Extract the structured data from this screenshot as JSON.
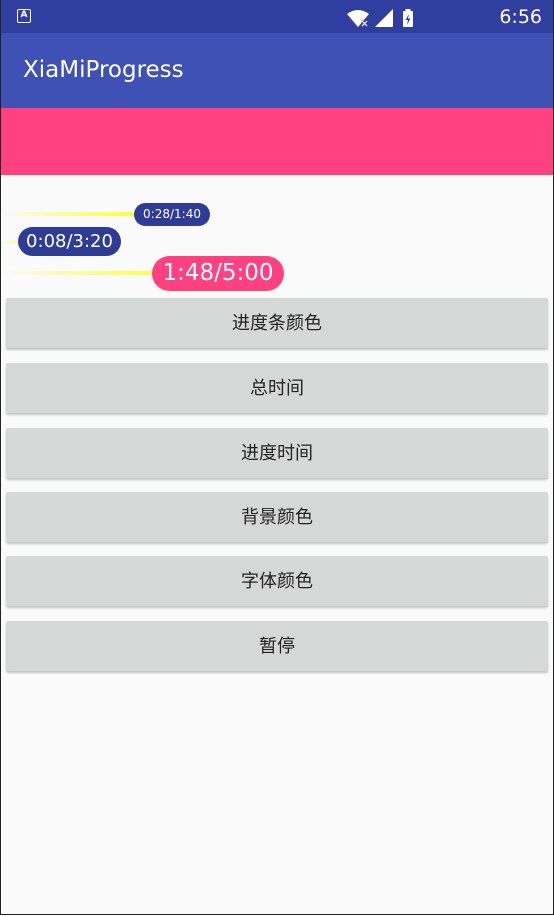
{
  "status_bar": {
    "time": "6:56",
    "notification_icon": "android-a-icon",
    "icons": [
      "wifi-icon",
      "signal-icon",
      "battery-icon"
    ]
  },
  "app_bar": {
    "title": "XiaMiProgress"
  },
  "colors": {
    "primary": "#3f51b5",
    "primary_dark": "#303f9f",
    "accent": "#ff4081",
    "pill_dark": "#2e3c96",
    "track_yellow": "#ffff00",
    "button_bg": "#d6d7d7"
  },
  "progress": [
    {
      "label": "0:28/1:40",
      "fraction": 0.28
    },
    {
      "label": "0:08/3:20",
      "fraction": 0.04
    },
    {
      "label": "1:48/5:00",
      "fraction": 0.36
    }
  ],
  "buttons": {
    "progress_color": "进度条颜色",
    "total_time": "总时间",
    "progress_time": "进度时间",
    "background_color": "背景颜色",
    "font_color": "字体颜色",
    "pause": "暂停"
  }
}
